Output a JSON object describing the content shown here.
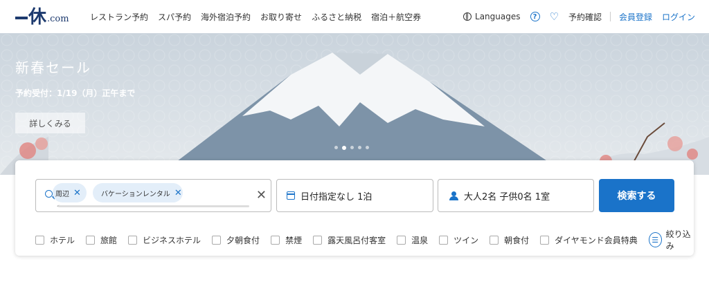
{
  "header": {
    "logo_dotcom": ".com",
    "nav": [
      "レストラン予約",
      "スパ予約",
      "海外宿泊予約",
      "お取り寄せ",
      "ふるさと納税",
      "宿泊＋航空券"
    ],
    "languages": "Languages",
    "help_icon_text": "?",
    "booking_check": "予約確認",
    "register": "会員登録",
    "login": "ログイン"
  },
  "hero": {
    "title": "新春セール",
    "subtitle": "予約受付：1/19（月）正午まで",
    "more_button": "詳しくみる",
    "slide_count": 5,
    "active_slide": 2
  },
  "search": {
    "chips": [
      "周辺",
      "バケーションレンタル"
    ],
    "date_label": "日付指定なし 1泊",
    "guest_label": "大人2名  子供0名  1室",
    "search_button": "検索する",
    "filters": [
      "ホテル",
      "旅館",
      "ビジネスホテル",
      "夕朝食付",
      "禁煙",
      "露天風呂付客室",
      "温泉",
      "ツイン",
      "朝食付",
      "ダイヤモンド会員特典"
    ],
    "narrow_label": "絞り込み"
  }
}
